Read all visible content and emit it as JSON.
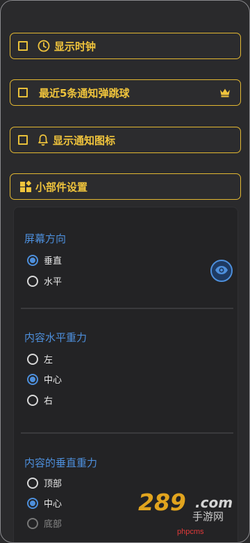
{
  "options": {
    "show_clock": {
      "label": "显示时钟",
      "checked": false
    },
    "recent_notifications": {
      "label": "最近5条通知弹跳球",
      "checked": false
    },
    "show_notification_icon": {
      "label": "显示通知图标",
      "checked": false
    }
  },
  "widget_settings": {
    "label": "小部件设置"
  },
  "sections": {
    "orientation": {
      "title": "屏幕方向",
      "options": [
        "垂直",
        "水平"
      ],
      "selected": "垂直"
    },
    "horizontal_gravity": {
      "title": "内容水平重力",
      "options": [
        "左",
        "中心",
        "右"
      ],
      "selected": "中心"
    },
    "vertical_gravity": {
      "title": "内容的垂直重力",
      "options": [
        "顶部",
        "中心",
        "底部"
      ],
      "selected": "中心"
    }
  },
  "watermark": {
    "logo": "289.com",
    "sub": "手游网",
    "site": "phpcms"
  },
  "colors": {
    "accent_gold": "#e3b832",
    "accent_blue": "#4d8fdc",
    "background": "#2a2a2c"
  }
}
